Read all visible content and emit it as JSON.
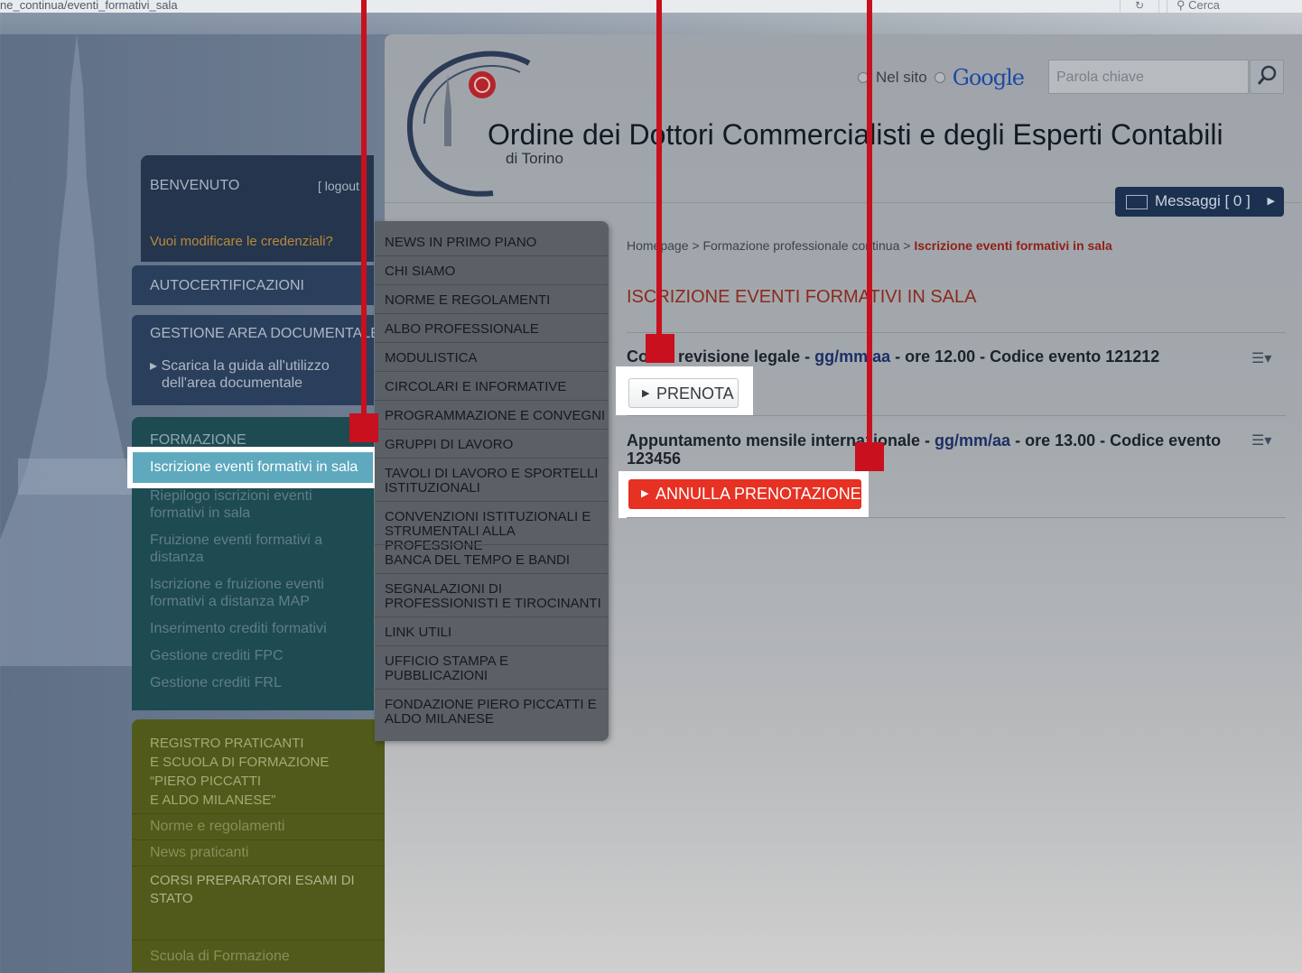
{
  "browser": {
    "url_fragment": "ne_continua/eventi_formativi_sala",
    "search_placeholder": "Cerca"
  },
  "header": {
    "radio_site": "Nel sito",
    "google_label": "Google",
    "search_placeholder": "Parola chiave",
    "org_name": "Ordine dei Dottori Commercialisti e degli Esperti Contabili",
    "org_city": "di Torino",
    "messages_label": "Messaggi [ 0 ]"
  },
  "breadcrumb": {
    "home": "Homepage",
    "sep1": " > ",
    "section": "Formazione professionale continua",
    "sep2": " > ",
    "current": "Iscrizione eventi formativi in sala"
  },
  "page": {
    "title": "ISCRIZIONE EVENTI FORMATIVI IN SALA"
  },
  "events": [
    {
      "name": "Corso revisione legale",
      "sep": " - ",
      "date": "gg/mm/aa",
      "details": " - ore 12.00 - Codice evento 121212",
      "button": "PRENOTA"
    },
    {
      "name": "Appuntamento mensile internazionale",
      "sep": " - ",
      "date": "gg/mm/aa",
      "details": " - ore 13.00 - Codice evento",
      "code": "123456",
      "button": "ANNULLA PRENOTAZIONE"
    }
  ],
  "sidebar": {
    "welcome": "BENVENUTO",
    "logout": "[ logout ]",
    "credentials": "Vuoi modificare le credenziali?",
    "autocert": "AUTOCERTIFICAZIONI",
    "docs_header": "GESTIONE AREA DOCUMENTALE",
    "docs_link_1": "Scarica la guida all'utilizzo",
    "docs_link_2": "dell'area documentale",
    "formazione": {
      "header": "FORMAZIONE",
      "selected": "Iscrizione eventi formativi in sala",
      "items": [
        "Riepilogo iscrizioni eventi formativi in sala",
        "Fruizione eventi formativi a distanza",
        "Iscrizione e fruizione eventi formativi a distanza MAP",
        "Inserimento crediti formativi",
        "Gestione crediti FPC",
        "Gestione crediti FRL"
      ]
    },
    "registro": {
      "header_1": "REGISTRO PRATICANTI",
      "header_2": "E SCUOLA DI FORMAZIONE",
      "header_3": "“PIERO PICCATTI",
      "header_4": "E ALDO MILANESE”",
      "items": [
        "Norme e regolamenti",
        "News praticanti"
      ],
      "corsi_1": "CORSI PREPARATORI ESAMI DI",
      "corsi_2": "STATO",
      "scuola": "Scuola di Formazione"
    }
  },
  "megamenu": [
    "NEWS IN PRIMO PIANO",
    "CHI SIAMO",
    "NORME E REGOLAMENTI",
    "ALBO PROFESSIONALE",
    "MODULISTICA",
    "CIRCOLARI E INFORMATIVE",
    "PROGRAMMAZIONE E CONVEGNI",
    "GRUPPI DI LAVORO",
    "TAVOLI DI LAVORO E SPORTELLI ISTITUZIONALI",
    "CONVENZIONI ISTITUZIONALI E STRUMENTALI ALLA PROFESSIONE",
    "BANCA DEL TEMPO E BANDI",
    "SEGNALAZIONI DI PROFESSIONISTI E TIROCINANTI",
    "LINK UTILI",
    "UFFICIO STAMPA E PUBBLICAZIONI",
    "FONDAZIONE PIERO PICCATTI E ALDO MILANESE"
  ],
  "colors": {
    "accent_red": "#c8101e",
    "annulla_red": "#e63123",
    "nav_dark_blue": "#1c3150",
    "selected_teal": "#5ea9bd"
  }
}
